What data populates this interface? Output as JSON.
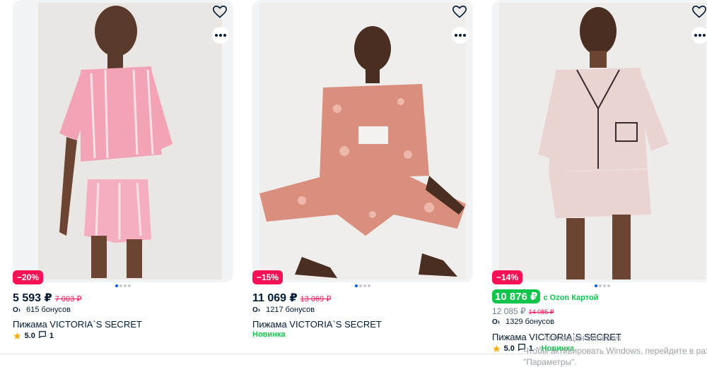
{
  "products": [
    {
      "discount": "−20%",
      "price": "5 593 ₽",
      "old_price": "7 003 ₽",
      "bonus": "615 бонусов",
      "title": "Пижама VICTORIA`S SECRET",
      "rating": "5.0",
      "reviews": "1"
    },
    {
      "discount": "−15%",
      "price": "11 069 ₽",
      "old_price": "13 069 ₽",
      "bonus": "1217 бонусов",
      "title": "Пижама VICTORIA`S SECRET",
      "tag": "Новинка"
    },
    {
      "discount": "−14%",
      "ozon_price": "10 876 ₽",
      "ozon_label": "с Ozon Картой",
      "price": "12 085 ₽",
      "old_price": "14 085 ₽",
      "bonus": "1329 бонусов",
      "title": "Пижама VICTORIA`S SECRET",
      "rating": "5.0",
      "reviews": "1",
      "tag": "Новинка"
    }
  ],
  "windows_watermark": {
    "line1": "Активация Windows",
    "line2": "Чтобы активировать Windows, перейдите в раздел",
    "line3": "\"Параметры\"."
  },
  "icons": {
    "favorite": "heart-icon",
    "more": "more-icon",
    "bonus": "bonus-icon",
    "rating": "star-icon",
    "reviews": "comment-icon"
  },
  "colors": {
    "discount_badge": "#f91155",
    "old_price": "#f91155",
    "ozon_card": "#10c44c",
    "new_tag": "#10c44c",
    "carousel_active": "#005bff",
    "star": "#ffa800"
  }
}
